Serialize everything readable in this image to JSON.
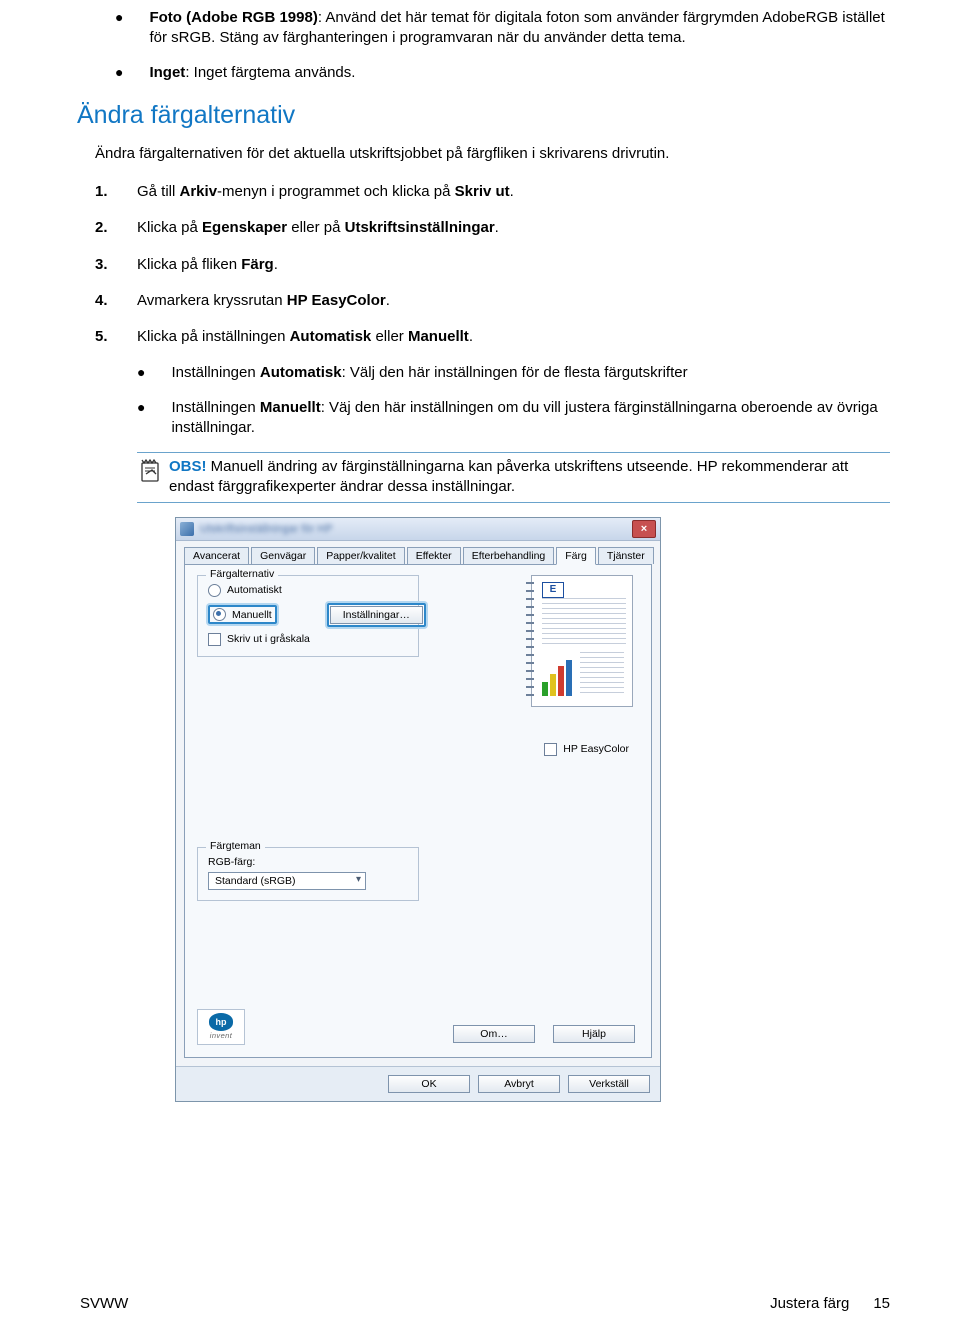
{
  "bullets_top": [
    {
      "label": "Foto (Adobe RGB 1998)",
      "rest": ": Använd det här temat för digitala foton som använder färgrymden AdobeRGB istället för sRGB. Stäng av färghanteringen i programvaran när du använder detta tema."
    },
    {
      "label": "Inget",
      "rest": ": Inget färgtema används."
    }
  ],
  "heading": "Ändra färgalternativ",
  "intro": "Ändra färgalternativen för det aktuella utskriftsjobbet på färgfliken i skrivarens drivrutin.",
  "steps": [
    {
      "n": "1.",
      "text_a": "Gå till ",
      "b1": "Arkiv",
      "text_b": "-menyn i programmet och klicka på ",
      "b2": "Skriv ut",
      "text_c": "."
    },
    {
      "n": "2.",
      "text_a": "Klicka på ",
      "b1": "Egenskaper",
      "text_b": " eller på ",
      "b2": "Utskriftsinställningar",
      "text_c": "."
    },
    {
      "n": "3.",
      "text_a": "Klicka på fliken ",
      "b1": "Färg",
      "text_b": "",
      "b2": "",
      "text_c": "."
    },
    {
      "n": "4.",
      "text_a": "Avmarkera kryssrutan ",
      "b1": "HP EasyColor",
      "text_b": "",
      "b2": "",
      "text_c": "."
    },
    {
      "n": "5.",
      "text_a": "Klicka på inställningen ",
      "b1": "Automatisk",
      "text_b": " eller ",
      "b2": "Manuellt",
      "text_c": "."
    }
  ],
  "sub": [
    {
      "b": "Automatisk",
      "text": ": Välj den här inställningen för de flesta färgutskrifter"
    },
    {
      "b": "Manuellt",
      "text": ": Väj den här inställningen om du vill justera färginställningarna oberoende av övriga inställningar."
    }
  ],
  "note": {
    "obs": "OBS!",
    "text": "   Manuell ändring av färginställningarna kan påverka utskriftens utseende. HP rekommenderar att endast färggrafikexperter ändrar dessa inställningar."
  },
  "dialog": {
    "blur_title": "Utskriftsinställningar för HP",
    "close": "×",
    "tabs": [
      "Avancerat",
      "Genvägar",
      "Papper/kvalitet",
      "Effekter",
      "Efterbehandling",
      "Färg",
      "Tjänster"
    ],
    "active_tab": "Färg",
    "group_farg": "Färgalternativ",
    "radio_auto": "Automatiskt",
    "radio_man": "Manuellt",
    "btn_install": "Inställningar…",
    "check_gray": "Skriv ut i gråskala",
    "easycolor": "HP EasyColor",
    "preview_letter": "E",
    "group_tema": "Färgteman",
    "rgb_label": "RGB-färg:",
    "dropdown": "Standard (sRGB)",
    "hp": "hp",
    "invent": "invent",
    "btn_om": "Om…",
    "btn_help": "Hjälp",
    "footer_ok": "OK",
    "footer_cancel": "Avbryt",
    "footer_apply": "Verkställ"
  },
  "footer": {
    "left": "SVWW",
    "right_label": "Justera färg",
    "page": "15"
  }
}
